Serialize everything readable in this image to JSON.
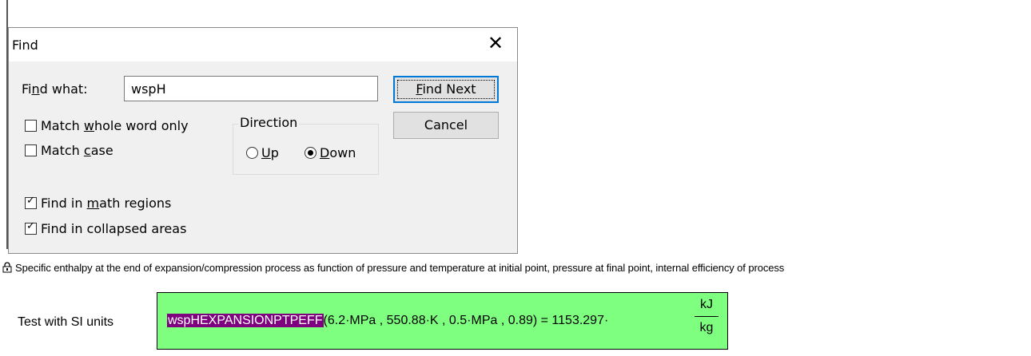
{
  "dialog": {
    "title": "Find",
    "close_glyph": "✕",
    "find_what": {
      "label_pre": "Fi",
      "label_u": "n",
      "label_post": "d what:",
      "value": "wspH"
    },
    "buttons": {
      "find_next_u": "F",
      "find_next_rest": "ind Next",
      "cancel": "Cancel"
    },
    "match_whole_word": {
      "pre": "Match ",
      "u": "w",
      "post": "hole word only",
      "checked": false
    },
    "match_case": {
      "pre": "Match ",
      "u": "c",
      "post": "ase",
      "checked": false
    },
    "direction": {
      "title": "Direction",
      "up": {
        "u": "U",
        "rest": "p",
        "selected": false
      },
      "down": {
        "u": "D",
        "rest": "own",
        "selected": true
      }
    },
    "find_in_math": {
      "pre": "Find in ",
      "u": "m",
      "post": "ath regions",
      "checked": true
    },
    "find_in_collapsed": {
      "pre": "Find in collapsed areas",
      "checked": true
    }
  },
  "worksheet": {
    "lock_icon": "lock-icon",
    "description": "Specific enthalpy at the end of expansion/compression process as function of pressure and temperature at initial point, pressure at final point, internal efficiency of process",
    "test_label": "Test with SI units",
    "formula": {
      "function_name": "wspHEXPANSIONPTPEFF",
      "args": "(6.2·MPa , 550.88·K , 0.5·MPa , 0.89) = 1153.297·",
      "unit_num": "kJ",
      "unit_den": "kg"
    },
    "region_color": "#7fff7f",
    "highlight_color": "#7f007f"
  }
}
